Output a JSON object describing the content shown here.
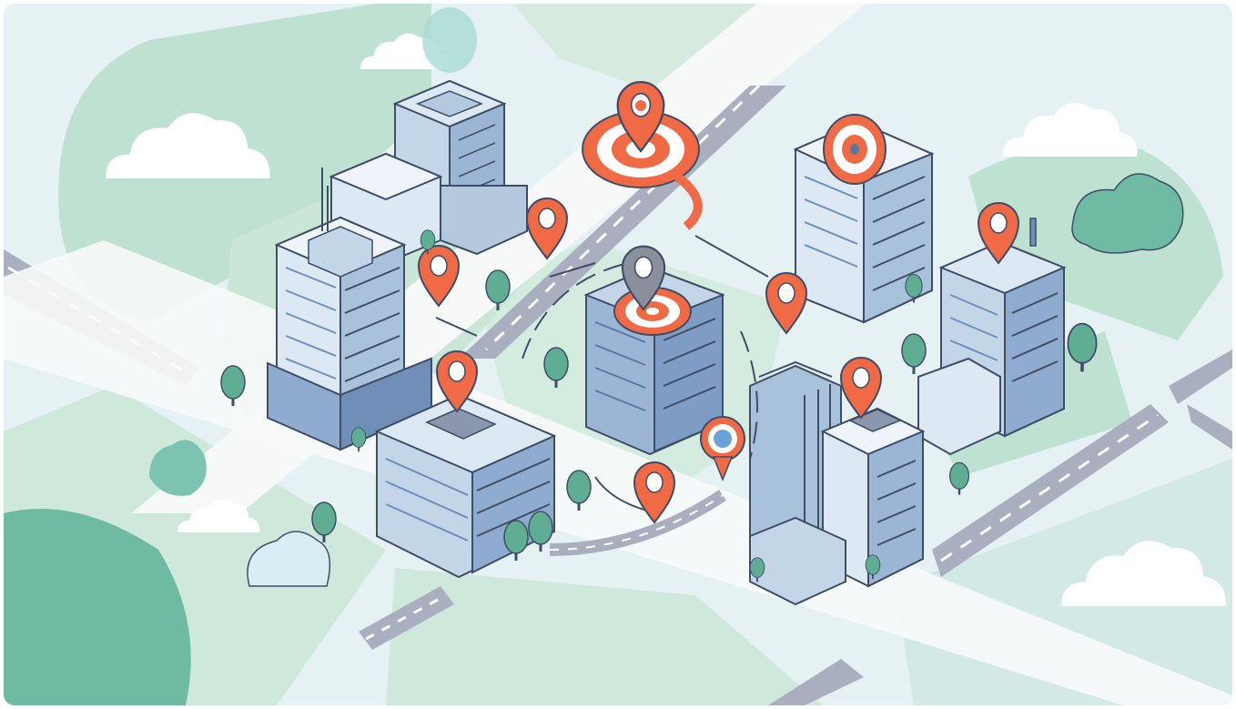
{
  "illustration": {
    "subject": "isometric-city-map",
    "palette": {
      "background": "#e6f1f4",
      "park": "#bfe1d2",
      "park_dark": "#7cc4b0",
      "road": "#ffffff",
      "asphalt": "#a9afbf",
      "building_light": "#dce8f3",
      "building_mid": "#a9c2dc",
      "building_dark": "#6f8fb8",
      "outline": "#3f4d66",
      "pin": "#ef6a45",
      "pin_grey": "#8a8f9c",
      "tree": "#5fae93"
    },
    "icons": [
      "map-pin-icon",
      "target-icon",
      "cloud-icon",
      "tree-icon",
      "building-icon"
    ]
  }
}
